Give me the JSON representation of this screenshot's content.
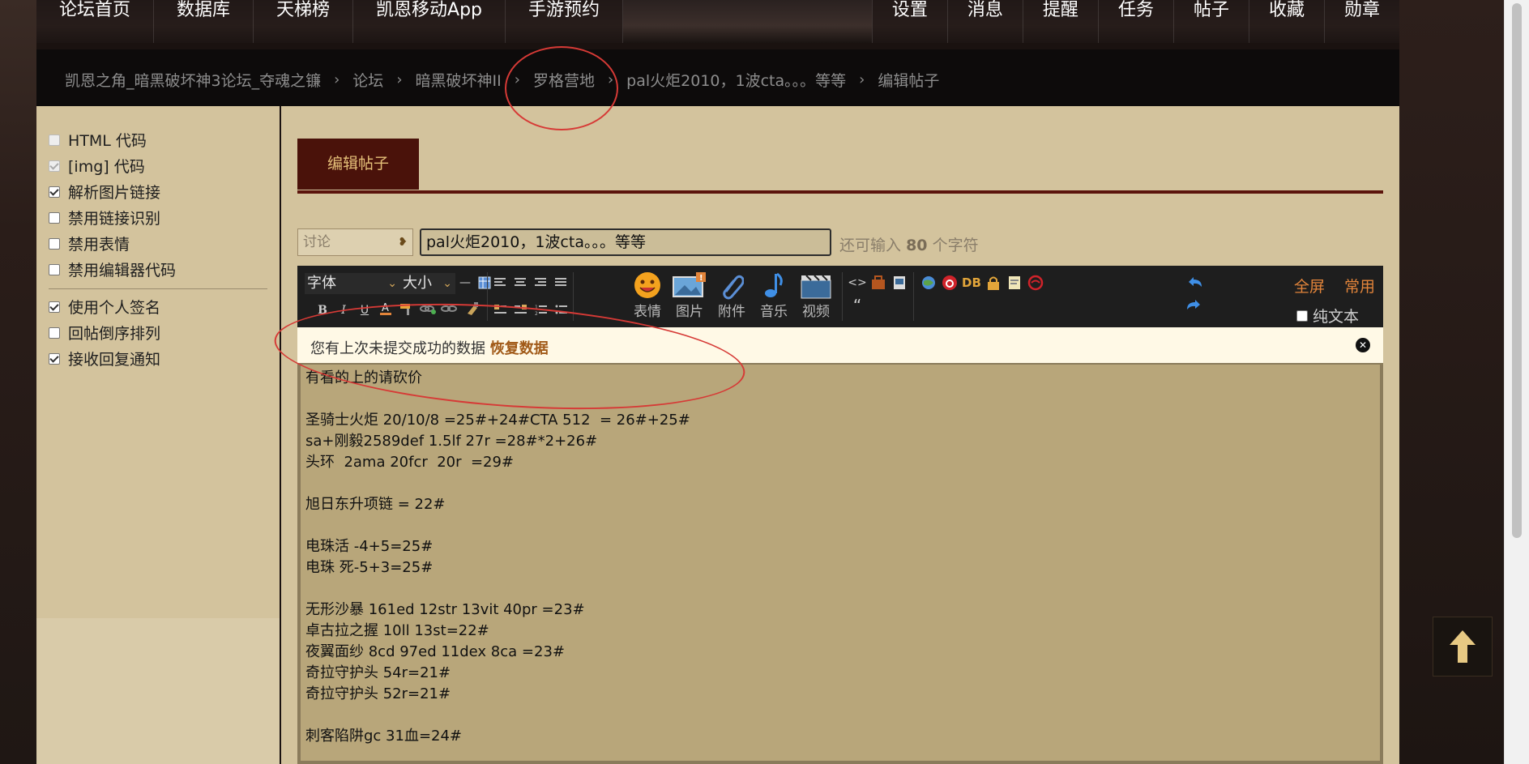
{
  "nav": {
    "left": [
      "论坛首页",
      "数据库",
      "天梯榜",
      "凯恩移动App",
      "手游预约"
    ],
    "right": [
      "设置",
      "消息",
      "提醒",
      "任务",
      "帖子",
      "收藏",
      "勋章"
    ]
  },
  "breadcrumb": [
    "凯恩之角_暗黑破坏神3论坛_夺魂之镰",
    "论坛",
    "暗黑破坏神II",
    "罗格营地",
    "pal火炬2010，1波cta。。。等等",
    "编辑帖子"
  ],
  "breadcrumb_sep": "›",
  "sidebar": {
    "options": [
      {
        "label": "HTML 代码",
        "checked": false,
        "disabled": true
      },
      {
        "label": "[img] 代码",
        "checked": true,
        "disabled": true
      },
      {
        "label": "解析图片链接",
        "checked": true,
        "disabled": false
      },
      {
        "label": "禁用链接识别",
        "checked": false,
        "disabled": false
      },
      {
        "label": "禁用表情",
        "checked": false,
        "disabled": false
      },
      {
        "label": "禁用编辑器代码",
        "checked": false,
        "disabled": false
      }
    ],
    "options2": [
      {
        "label": "使用个人签名",
        "checked": true
      },
      {
        "label": "回帖倒序排列",
        "checked": false
      },
      {
        "label": "接收回复通知",
        "checked": true
      }
    ]
  },
  "tab": {
    "label": "编辑帖子"
  },
  "form": {
    "type_value": "讨论",
    "subject_value": "pal火炬2010，1波cta。。。等等",
    "remain_prefix": "还可输入",
    "remain_count": "80",
    "remain_suffix": "个字符"
  },
  "toolbar": {
    "font_label": "字体",
    "size_label": "大小",
    "buttons": [
      "表情",
      "图片",
      "附件",
      "音乐",
      "视频"
    ],
    "fullscreen": "全屏",
    "common": "常用",
    "plaintext": "纯文本",
    "db_label": "DB"
  },
  "restore": {
    "text": "您有上次未提交成功的数据",
    "link": "恢复数据"
  },
  "content_lines": [
    "有看的上的请砍价",
    "",
    "圣骑士火炬 20/10/8 =25#+24#CTA 512  = 26#+25#",
    "sa+刚毅2589def 1.5lf 27r =28#*2+26#",
    "头环  2ama 20fcr  20r  =29#",
    "",
    "旭日东升项链 = 22#",
    "",
    "电珠活 -4+5=25#",
    "电珠 死-5+3=25#",
    "",
    "无形沙暴 161ed 12str 13vit 40pr =23#",
    "卓古拉之握 10ll 13st=22#",
    "夜翼面纱 8cd 97ed 11dex 8ca =23#",
    "奇拉守护头 54r=21#",
    "奇拉守护头 52r=21#",
    "",
    "刺客陷阱gc 31血=24#"
  ],
  "colors": {
    "accent": "#e2843a",
    "tab_bg": "#4a120a",
    "annotation": "#d63a36"
  }
}
